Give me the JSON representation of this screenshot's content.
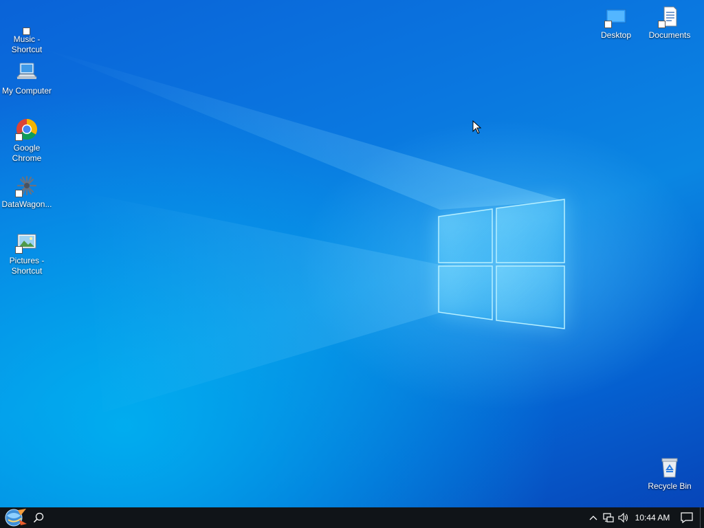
{
  "desktop": {
    "icons_left": [
      {
        "name": "music-shortcut",
        "label": "Music -\nShortcut",
        "icon": "music-icon"
      },
      {
        "name": "my-computer",
        "label": "My Computer",
        "icon": "computer-icon"
      },
      {
        "name": "google-chrome",
        "label": "Google\nChrome",
        "icon": "chrome-icon"
      },
      {
        "name": "datawagon",
        "label": "DataWagon...",
        "icon": "datawagon-icon"
      },
      {
        "name": "pictures-shortcut",
        "label": "Pictures -\nShortcut",
        "icon": "pictures-icon"
      }
    ],
    "icons_right": [
      {
        "name": "desktop",
        "label": "Desktop",
        "icon": "desktop-folder-icon"
      },
      {
        "name": "documents",
        "label": "Documents",
        "icon": "documents-icon"
      }
    ],
    "recycle_bin": {
      "label": "Recycle Bin",
      "icon": "recycle-bin-icon"
    }
  },
  "taskbar": {
    "start_icon": "start-orb-icon",
    "search_icon": "search-icon",
    "tray": {
      "chevron_icon": "chevron-up-icon",
      "network_icon": "network-icon",
      "volume_icon": "volume-icon",
      "clock": "10:44 AM",
      "notifications_icon": "action-center-icon"
    }
  },
  "colors": {
    "accent": "#0a78e0",
    "taskbar": "#101418"
  }
}
